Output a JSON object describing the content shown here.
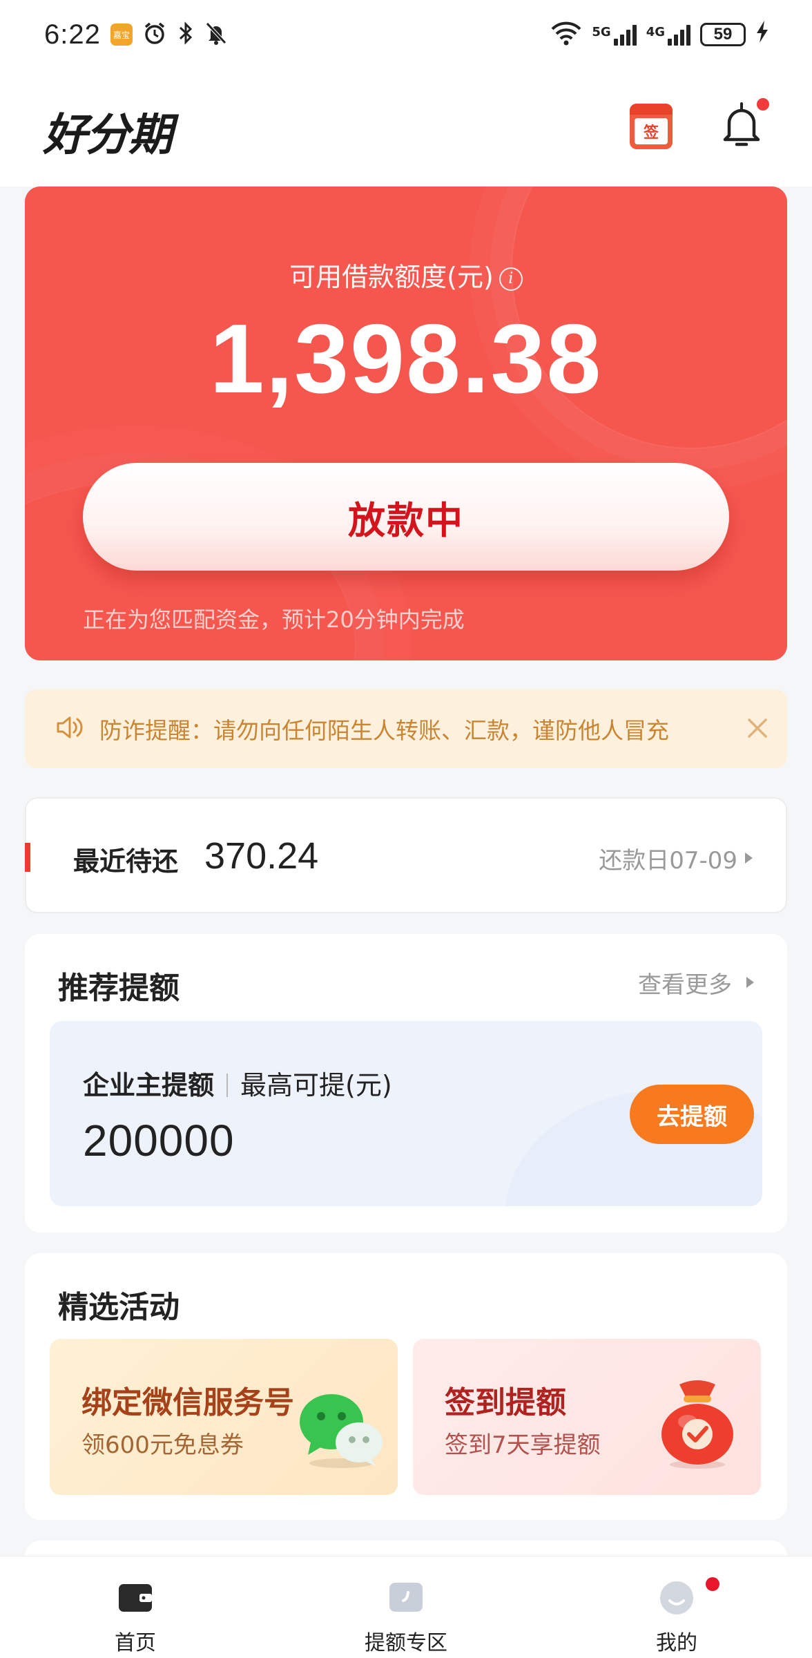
{
  "status_bar": {
    "time": "6:22",
    "app_badge": "嘉宝",
    "net1": "5G",
    "net2": "4G",
    "battery": "59",
    "icons": [
      "alarm-icon",
      "bluetooth-icon",
      "mute-icon",
      "wifi-icon",
      "signal-icon",
      "charging-icon"
    ]
  },
  "header": {
    "logo": "好分期",
    "checkin_icon_text": "签"
  },
  "credit_card": {
    "label": "可用借款额度(元)",
    "info_glyph": "i",
    "amount": "1,398.38",
    "status_button": "放款中",
    "note": "正在为您匹配资金，预计20分钟内完成"
  },
  "notice": {
    "text": "防诈提醒：请勿向任何陌生人转账、汇款，谨防他人冒充"
  },
  "repayment": {
    "label": "最近待还",
    "amount": "370.24",
    "due": "还款日07-09"
  },
  "recommend": {
    "title": "推荐提额",
    "more": "查看更多",
    "quota_type": "企业主提额",
    "quota_caption": "最高可提(元)",
    "quota_amount": "200000",
    "quota_button": "去提额"
  },
  "activities": {
    "title": "精选活动",
    "items": [
      {
        "title": "绑定微信服务号",
        "subtitle": "领600元免息券"
      },
      {
        "title": "签到提额",
        "subtitle": "签到7天享提额"
      }
    ]
  },
  "bottom_nav": {
    "items": [
      {
        "label": "首页"
      },
      {
        "label": "提额专区"
      },
      {
        "label": "我的"
      }
    ]
  },
  "colors": {
    "brand_red": "#f5564e",
    "status_text_red": "#d4141c",
    "notice_bg": "#fdf1dd",
    "notice_text": "#c98532",
    "cta_orange": "#f87a1e"
  }
}
